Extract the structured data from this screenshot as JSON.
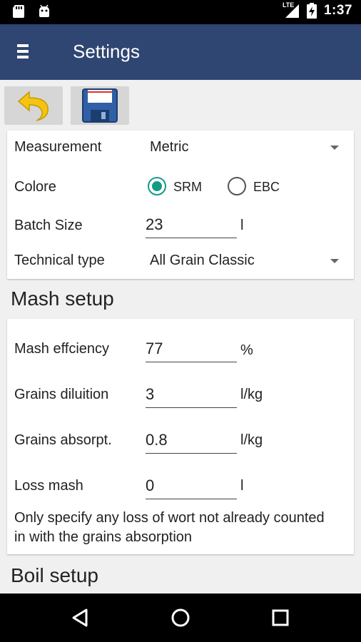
{
  "status_bar": {
    "time": "1:37",
    "network": "LTE"
  },
  "app_bar": {
    "title": "Settings"
  },
  "settings": {
    "measurement": {
      "label": "Measurement",
      "value": "Metric"
    },
    "color": {
      "label": "Colore",
      "options": [
        "SRM",
        "EBC"
      ],
      "selected": "SRM"
    },
    "batch_size": {
      "label": "Batch Size",
      "value": "23",
      "unit": "l"
    },
    "technical_type": {
      "label": "Technical type",
      "value": "All Grain Classic"
    }
  },
  "mash_setup": {
    "title": "Mash setup",
    "efficiency": {
      "label": "Mash effciency",
      "value": "77",
      "unit": "%"
    },
    "dilution": {
      "label": "Grains diluition",
      "value": "3",
      "unit": "l/kg"
    },
    "absorption": {
      "label": "Grains absorpt.",
      "value": "0.8",
      "unit": "l/kg"
    },
    "loss": {
      "label": "Loss mash",
      "value": "0",
      "unit": "l"
    },
    "note": "Only specify any loss of wort not already counted in with the grains absorption"
  },
  "boil_setup": {
    "title": "Boil setup"
  },
  "colors": {
    "app_bar": "#2f4672",
    "accent": "#149b86"
  }
}
